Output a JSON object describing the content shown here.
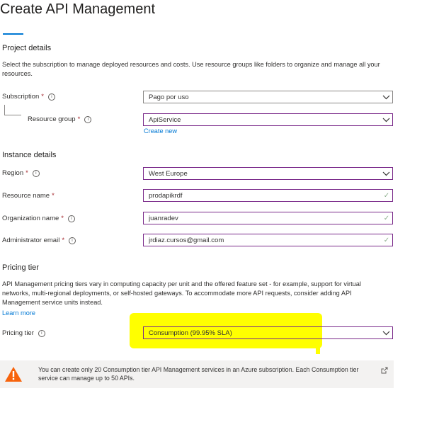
{
  "page": {
    "title": "Create API Management"
  },
  "project": {
    "heading": "Project details",
    "description": "Select the subscription to manage deployed resources and costs. Use resource groups like folders to organize and manage all your resources.",
    "subscription_label": "Subscription",
    "subscription_value": "Pago por uso",
    "resource_group_label": "Resource group",
    "resource_group_value": "ApiService",
    "create_new": "Create new"
  },
  "instance": {
    "heading": "Instance details",
    "region_label": "Region",
    "region_value": "West Europe",
    "resource_name_label": "Resource name",
    "resource_name_value": "prodapikrdf",
    "org_label": "Organization name",
    "org_value": "juanradev",
    "admin_label": "Administrator email",
    "admin_value": "jrdiaz.cursos@gmail.com"
  },
  "pricing": {
    "heading": "Pricing tier",
    "description": "API Management pricing tiers vary in computing capacity per unit and the offered feature set - for example, support for virtual networks, multi-regional deployments, or self-hosted gateways. To accommodate more API requests, consider adding API Management service units instead.",
    "learn_more": "Learn more",
    "tier_label": "Pricing tier",
    "tier_value": "Consumption (99.95% SLA)"
  },
  "warning": {
    "text": "You can create only 20 Consumption tier API Management services in an Azure subscription. Each Consumption tier service can manage up to 50 APIs."
  },
  "symbols": {
    "required": "*",
    "info": "i",
    "check": "✓"
  },
  "colors": {
    "accent": "#0078d4",
    "highlight": "#ffff00",
    "warning": "#f7630c",
    "input_border": "#7a2a8a"
  },
  "icons": {
    "info": "info-icon",
    "chevron": "chevron-down-icon",
    "check": "checkmark-icon",
    "warning": "warning-icon",
    "external": "external-link-icon"
  }
}
